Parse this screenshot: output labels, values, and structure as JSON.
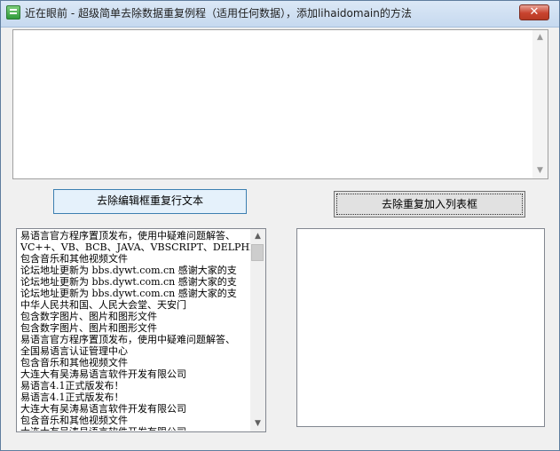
{
  "window": {
    "title": "近在眼前 - 超级简单去除数据重复例程（适用任何数据），添加lihaidomain的方法",
    "close_glyph": "✕"
  },
  "buttons": {
    "remove_duplicate_text": "去除编辑框重复行文本",
    "remove_duplicate_to_list": "去除重复加入列表框"
  },
  "source_list": {
    "items": [
      "易语言官方程序置顶发布，使用中疑难问题解答、",
      "VC++、VB、BCB、JAVA、VBSCRIPT、DELPHI",
      "包含音乐和其他视频文件",
      "论坛地址更新为 bbs.dywt.com.cn 感谢大家的支",
      "论坛地址更新为 bbs.dywt.com.cn 感谢大家的支",
      "论坛地址更新为 bbs.dywt.com.cn 感谢大家的支",
      "中华人民共和国、人民大会堂、天安门",
      "包含数字图片、图片和图形文件",
      "包含数字图片、图片和图形文件",
      "易语言官方程序置顶发布，使用中疑难问题解答、",
      "全国易语言认证管理中心",
      "包含音乐和其他视频文件",
      "大连大有吴涛易语言软件开发有限公司",
      "易语言4.1正式版发布！",
      "易语言4.1正式版发布！",
      "大连大有吴涛易语言软件开发有限公司",
      "包含音乐和其他视频文件",
      "大连大有吴涛易语言软件开发有限公司"
    ]
  },
  "icons": {
    "app": "app-icon",
    "scroll_up": "▲",
    "scroll_down": "▼"
  },
  "colors": {
    "titlebar": "#c6d9ef",
    "close_button": "#c8432e",
    "focused_button": "#e5f1fb"
  }
}
